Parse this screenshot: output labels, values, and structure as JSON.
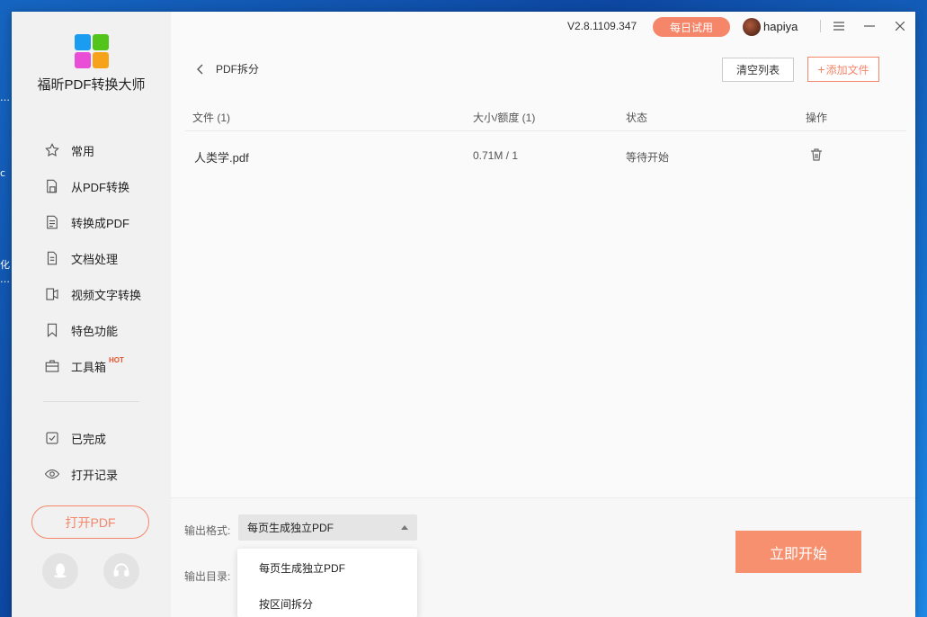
{
  "desktop": {
    "edge_glyphs": [
      "…",
      "c",
      "化",
      "…"
    ]
  },
  "app": {
    "name": "福昕PDF转换大师",
    "version": "V2.8.1109.347",
    "trial_label": "每日试用",
    "username": "hapiya"
  },
  "sidebar": {
    "items": [
      {
        "label": "常用",
        "icon": "star-icon"
      },
      {
        "label": "从PDF转换",
        "icon": "from-pdf-icon"
      },
      {
        "label": "转换成PDF",
        "icon": "to-pdf-icon"
      },
      {
        "label": "文档处理",
        "icon": "document-icon"
      },
      {
        "label": "视频文字转换",
        "icon": "video-text-icon"
      },
      {
        "label": "特色功能",
        "icon": "bookmark-icon"
      },
      {
        "label": "工具箱",
        "icon": "toolbox-icon",
        "badge": "HOT"
      }
    ],
    "secondary_items": [
      {
        "label": "已完成",
        "icon": "check-icon"
      },
      {
        "label": "打开记录",
        "icon": "eye-icon"
      }
    ],
    "open_pdf_label": "打开PDF"
  },
  "header": {
    "breadcrumb": "PDF拆分",
    "clear_label": "清空列表",
    "add_label": "添加文件",
    "add_prefix": "+"
  },
  "table": {
    "columns": [
      "文件 (1)",
      "大小/额度 (1)",
      "状态",
      "操作"
    ],
    "rows": [
      {
        "file": "人类学.pdf",
        "size": "0.71M / 1",
        "status": "等待开始"
      }
    ]
  },
  "bottom": {
    "format_label": "输出格式:",
    "format_value": "每页生成独立PDF",
    "dir_label": "输出目录:",
    "start_label": "立即开始",
    "dropdown_options": [
      "每页生成独立PDF",
      "按区间拆分"
    ]
  },
  "colors": {
    "accent": "#f5866a",
    "start": "#f7906f",
    "sidebar_bg": "#f1f1f1"
  }
}
